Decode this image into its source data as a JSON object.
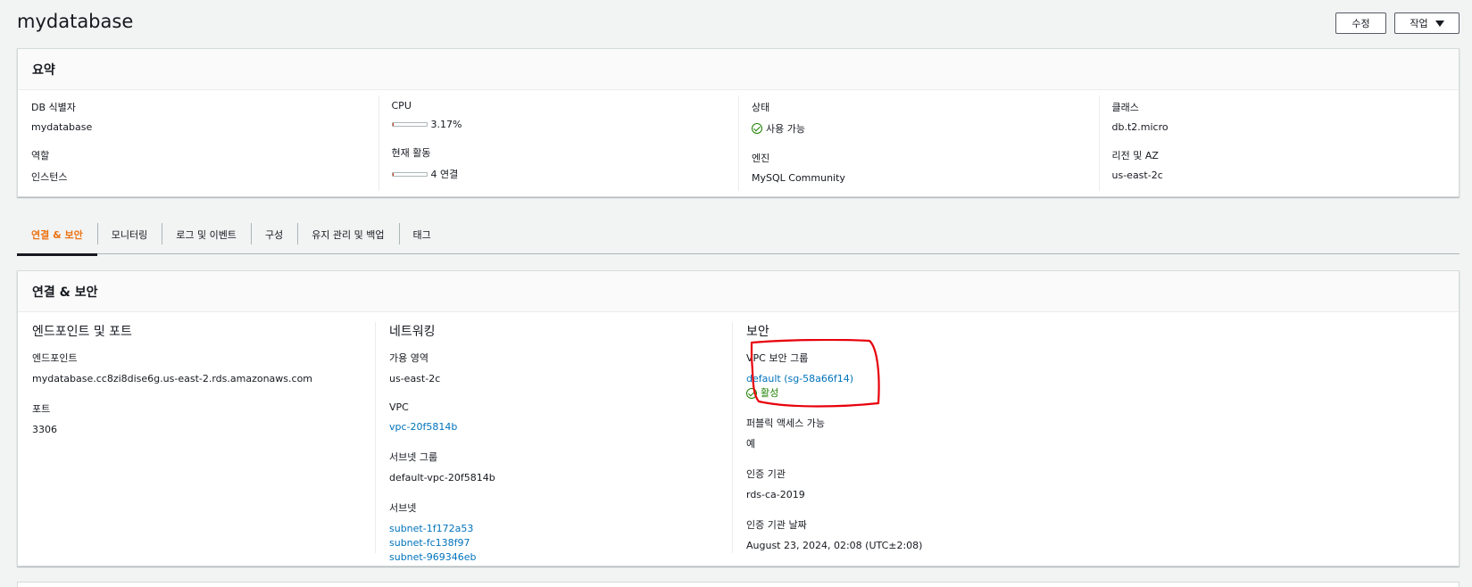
{
  "header": {
    "title": "mydatabase",
    "edit_label": "수정",
    "action_label": "작업"
  },
  "summary": {
    "title": "요약",
    "db_id_label": "DB 식별자",
    "db_id_value": "mydatabase",
    "role_label": "역할",
    "role_value": "인스턴스",
    "cpu_label": "CPU",
    "cpu_value": "3.17%",
    "cpu_fraction": 0.0317,
    "activity_label": "현재 활동",
    "activity_value": "4 연결",
    "activity_fraction": 0.04,
    "status_label": "상태",
    "status_value": "사용 가능",
    "engine_label": "엔진",
    "engine_value": "MySQL Community",
    "class_label": "클래스",
    "class_value": "db.t2.micro",
    "region_label": "리전 및 AZ",
    "region_value": "us-east-2c"
  },
  "tabs": [
    {
      "label": "연결 & 보안",
      "active": true
    },
    {
      "label": "모니터링",
      "active": false
    },
    {
      "label": "로그 및 이벤트",
      "active": false
    },
    {
      "label": "구성",
      "active": false
    },
    {
      "label": "유지 관리 및 백업",
      "active": false
    },
    {
      "label": "태그",
      "active": false
    }
  ],
  "connectivity": {
    "title": "연결 & 보안",
    "endpoint_section": {
      "title": "엔드포인트 및 포트",
      "endpoint_label": "엔드포인트",
      "endpoint_value": "mydatabase.cc8zi8dise6g.us-east-2.rds.amazonaws.com",
      "port_label": "포트",
      "port_value": "3306"
    },
    "networking_section": {
      "title": "네트워킹",
      "az_label": "가용 영역",
      "az_value": "us-east-2c",
      "vpc_label": "VPC",
      "vpc_value": "vpc-20f5814b",
      "subnet_group_label": "서브넷 그룹",
      "subnet_group_value": "default-vpc-20f5814b",
      "subnets_label": "서브넷",
      "subnets": [
        "subnet-1f172a53",
        "subnet-fc138f97",
        "subnet-969346eb"
      ]
    },
    "security_section": {
      "title": "보안",
      "sg_label": "VPC 보안 그룹",
      "sg_value": "default (sg-58a66f14)",
      "sg_status": "활성",
      "public_label": "퍼블릭 액세스 가능",
      "public_value": "예",
      "ca_label": "인증 기관",
      "ca_value": "rds-ca-2019",
      "ca_date_label": "인증 기관 날짜",
      "ca_date_value": "August 23, 2024, 02:08 (UTC±2:08)"
    }
  },
  "colors": {
    "accent_tab": "#ec7211",
    "link": "#0073bb",
    "success": "#1d8102",
    "annotation": "#e8000b"
  }
}
